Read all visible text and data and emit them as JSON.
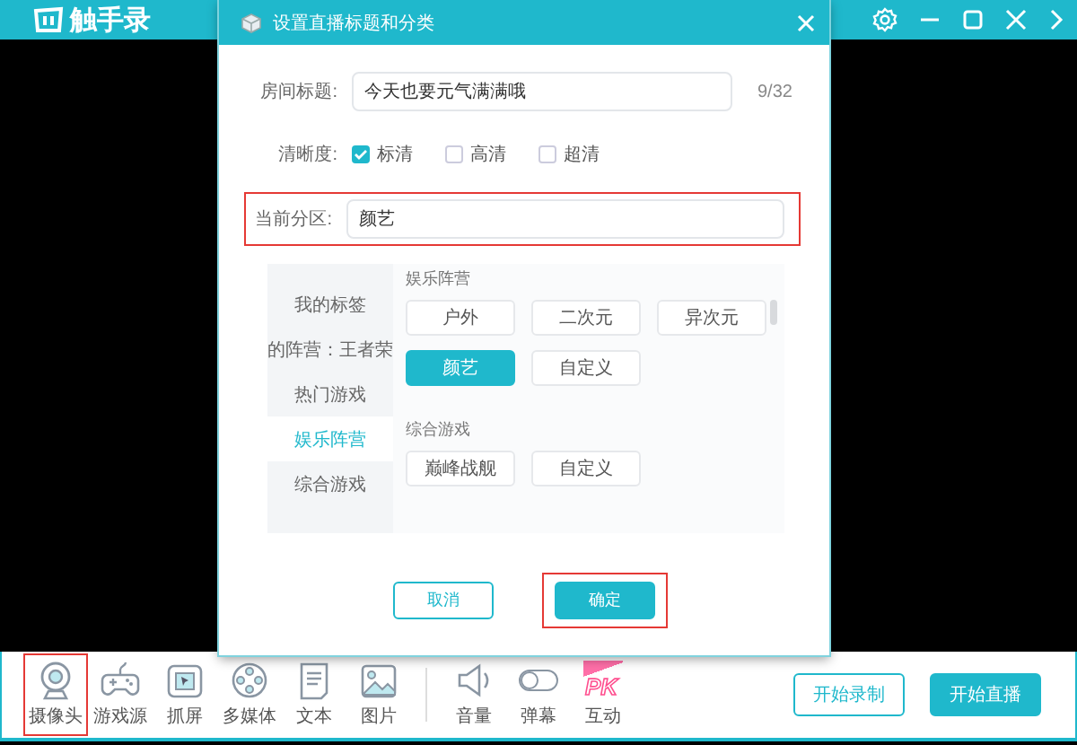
{
  "app": {
    "logo_text": "触手录"
  },
  "dialog": {
    "title": "设置直播标题和分类",
    "title_field": {
      "label": "房间标题:",
      "value": "今天也要元气满满哦",
      "counter": "9/32"
    },
    "clarity": {
      "label": "清晰度:",
      "options": [
        {
          "label": "标清",
          "checked": true
        },
        {
          "label": "高清",
          "checked": false
        },
        {
          "label": "超清",
          "checked": false
        }
      ]
    },
    "zone": {
      "label": "当前分区:",
      "value": "颜艺",
      "highlighted": true
    },
    "sidebar": [
      {
        "label": "我的标签",
        "selected": false
      },
      {
        "label": "的阵营：王者荣",
        "selected": false
      },
      {
        "label": "热门游戏",
        "selected": false
      },
      {
        "label": "娱乐阵营",
        "selected": true
      },
      {
        "label": "综合游戏",
        "selected": false
      }
    ],
    "sections": [
      {
        "title": "娱乐阵营",
        "tags": [
          {
            "label": "户外",
            "selected": false
          },
          {
            "label": "二次元",
            "selected": false
          },
          {
            "label": "异次元",
            "selected": false
          },
          {
            "label": "颜艺",
            "selected": true
          },
          {
            "label": "自定义",
            "selected": false
          }
        ]
      },
      {
        "title": "综合游戏",
        "tags": [
          {
            "label": "巅峰战舰",
            "selected": false
          },
          {
            "label": "自定义",
            "selected": false
          }
        ]
      }
    ],
    "buttons": [
      {
        "label": "取消",
        "kind": "secondary",
        "highlighted": false
      },
      {
        "label": "确定",
        "kind": "primary",
        "highlighted": true
      }
    ]
  },
  "toolbar": {
    "sources": [
      {
        "label": "摄像头",
        "kind": "camera",
        "highlighted": true
      },
      {
        "label": "游戏源",
        "kind": "gamepad",
        "highlighted": false
      },
      {
        "label": "抓屏",
        "kind": "capture",
        "highlighted": false
      },
      {
        "label": "多媒体",
        "kind": "media",
        "highlighted": false
      },
      {
        "label": "文本",
        "kind": "text",
        "highlighted": false
      },
      {
        "label": "图片",
        "kind": "image",
        "highlighted": false
      }
    ],
    "controls": [
      {
        "label": "音量",
        "kind": "volume"
      },
      {
        "label": "弹幕",
        "kind": "toggle",
        "on": false
      },
      {
        "label": "互动",
        "kind": "pk",
        "badge_text": "PK"
      }
    ],
    "buttons": [
      {
        "label": "开始录制",
        "kind": "secondary"
      },
      {
        "label": "开始直播",
        "kind": "primary"
      }
    ]
  }
}
